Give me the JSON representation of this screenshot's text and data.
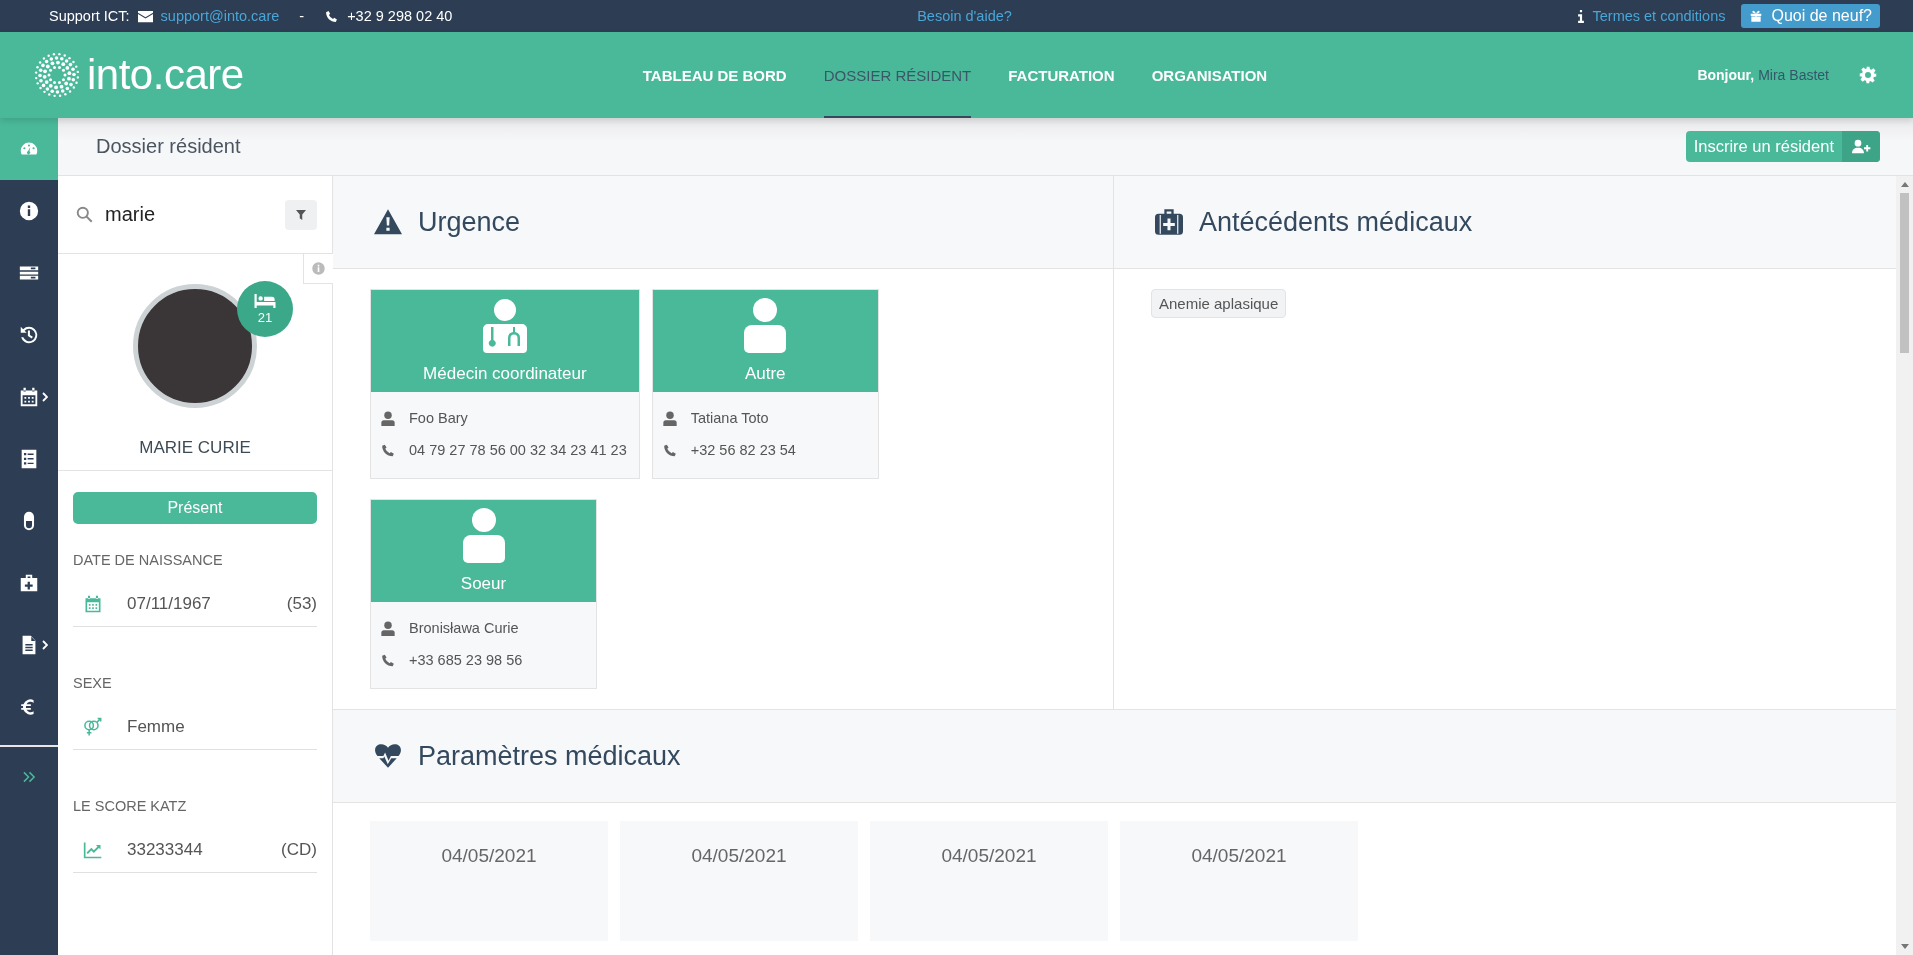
{
  "top_bar": {
    "support_label": "Support ICT:",
    "email": "support@into.care",
    "separator": "-",
    "phone": "+32 9 298 02 40",
    "help_link": "Besoin d'aide?",
    "terms_link": "Termes et conditions",
    "news_button": "Quoi de neuf?"
  },
  "header": {
    "logo_text": "into.care",
    "nav": [
      {
        "label": "TABLEAU DE BORD",
        "selected": false
      },
      {
        "label": "DOSSIER RÉSIDENT",
        "selected": true
      },
      {
        "label": "FACTURATION",
        "selected": false
      },
      {
        "label": "ORGANISATION",
        "selected": false
      }
    ],
    "greeting": "Bonjour,",
    "user_name": "Mira Bastet"
  },
  "side_rail": {
    "items": [
      {
        "selected": true,
        "submenu": false
      },
      {
        "selected": false,
        "submenu": false
      },
      {
        "selected": false,
        "submenu": false
      },
      {
        "selected": false,
        "submenu": false
      },
      {
        "selected": false,
        "submenu": true
      },
      {
        "selected": false,
        "submenu": false
      },
      {
        "selected": false,
        "submenu": false
      },
      {
        "selected": false,
        "submenu": false
      },
      {
        "selected": false,
        "submenu": true
      },
      {
        "selected": false,
        "submenu": false
      }
    ]
  },
  "page": {
    "title": "Dossier résident",
    "register_button": "Inscrire un résident"
  },
  "resident": {
    "search": {
      "value": "marie"
    },
    "room": "21",
    "name": "MARIE CURIE",
    "status": "Présent",
    "fields": [
      {
        "label": "DATE DE NAISSANCE",
        "kind": "calendar",
        "value": "07/11/1967",
        "extra": "(53)"
      },
      {
        "label": "SEXE",
        "kind": "gender",
        "value": "Femme"
      },
      {
        "label": "LE SCORE KATZ",
        "kind": "chart",
        "value": "33233344",
        "extra": "(CD)"
      }
    ]
  },
  "emergency": {
    "title": "Urgence",
    "contacts": [
      {
        "role": "Médecin coordinateur",
        "kind": "doctor",
        "name": "Foo Bary",
        "phone": "04 79 27 78 56 00 32 34 23 41 23"
      },
      {
        "role": "Autre",
        "kind": "person",
        "name": "Tatiana Toto",
        "phone": "+32 56 82 23 54"
      },
      {
        "role": "Soeur",
        "kind": "person",
        "name": "Bronisława Curie",
        "phone": "+33 685 23 98 56"
      }
    ]
  },
  "history": {
    "title": "Antécédents médicaux",
    "tags": [
      "Anemie aplasique"
    ]
  },
  "parameters": {
    "title": "Paramètres médicaux",
    "entries": [
      {
        "date": "04/05/2021"
      },
      {
        "date": "04/05/2021"
      },
      {
        "date": "04/05/2021"
      },
      {
        "date": "04/05/2021"
      }
    ]
  }
}
